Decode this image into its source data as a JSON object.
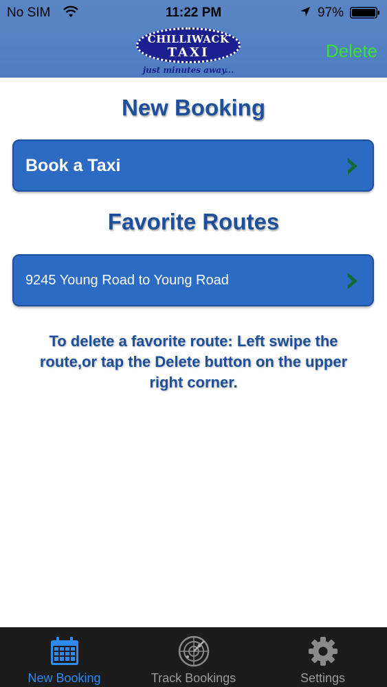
{
  "status_bar": {
    "carrier": "No SIM",
    "time": "11:22 PM",
    "battery": "97%"
  },
  "header": {
    "logo": {
      "top_text": "CHILLIWACK",
      "bottom_text": "TAXI",
      "tagline": "just minutes away..."
    },
    "delete_label": "Delete"
  },
  "main": {
    "new_booking_title": "New Booking",
    "book_taxi_label": "Book a Taxi",
    "favorites_title": "Favorite Routes",
    "routes": [
      {
        "label": "9245 Young Road to Young Road"
      }
    ],
    "hint": "To delete a favorite route: Left swipe the route,or tap the Delete button on the upper right corner."
  },
  "tab_bar": {
    "tabs": [
      {
        "label": "New Booking",
        "icon": "calendar-icon"
      },
      {
        "label": "Track Bookings",
        "icon": "radar-icon"
      },
      {
        "label": "Settings",
        "icon": "gear-icon"
      }
    ],
    "active_index": 0
  },
  "colors": {
    "header": "#5a86c5",
    "button": "#2b6bc4",
    "title": "#1d4f9a",
    "delete": "#39e03c",
    "chevron": "#0f6b2e",
    "tab_active": "#2f8bf0",
    "tab_inactive": "#9a9a9a",
    "tab_bar": "#1c1c1c"
  }
}
